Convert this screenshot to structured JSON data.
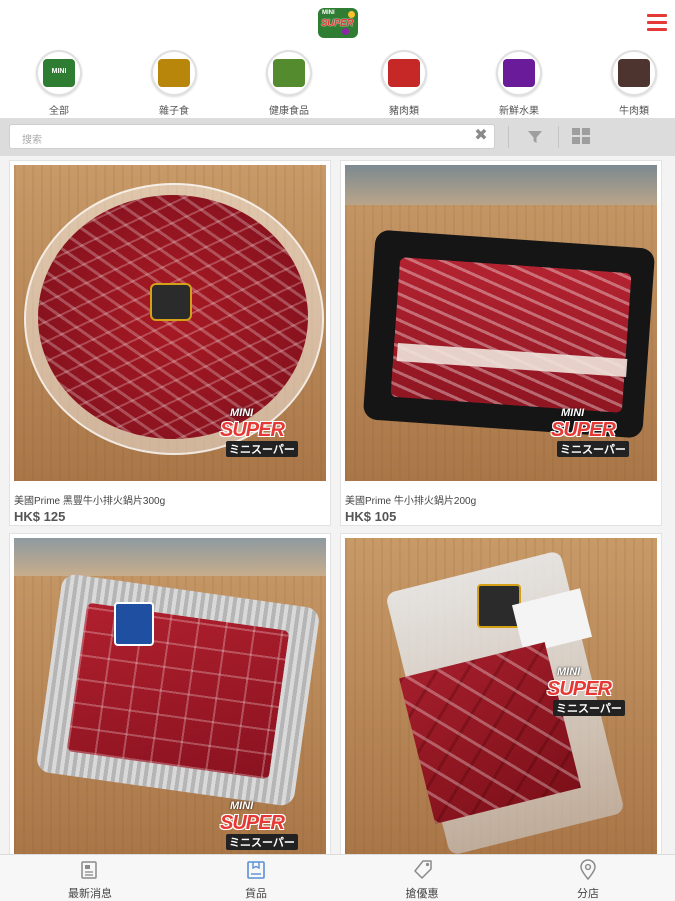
{
  "header": {
    "logo": {
      "line1": "MINI",
      "line2": "SUPER"
    },
    "menu_icon": "hamburger-menu-icon"
  },
  "categories": [
    {
      "label": "全部",
      "icon": "all-category-icon",
      "color": "#2e7d32"
    },
    {
      "label": "雜子食",
      "icon": "snacks-icon",
      "color": "#b8860b"
    },
    {
      "label": "健康食品",
      "icon": "health-food-icon",
      "color": "#558b2f"
    },
    {
      "label": "豬肉類",
      "icon": "pork-icon",
      "color": "#c62828"
    },
    {
      "label": "新鮮水果",
      "icon": "fresh-fruit-icon",
      "color": "#6a1b9a"
    },
    {
      "label": "牛肉類",
      "icon": "beef-icon",
      "color": "#4e342e"
    }
  ],
  "search": {
    "placeholder": "搜索"
  },
  "products": [
    {
      "name": "美國Prime 黑豐牛小排火鍋片300g",
      "price": "HK$ 125"
    },
    {
      "name": "美國Prime 牛小排火鍋片200g",
      "price": "HK$ 105"
    },
    {
      "name": "",
      "price": ""
    },
    {
      "name": "",
      "price": ""
    }
  ],
  "tabbar": [
    {
      "label": "最新消息",
      "icon": "news-icon"
    },
    {
      "label": "貨品",
      "icon": "products-icon"
    },
    {
      "label": "搶優惠",
      "icon": "coupon-tag-icon"
    },
    {
      "label": "分店",
      "icon": "location-pin-icon"
    }
  ],
  "colors": {
    "accent": "#e53935",
    "active_tab": "#5b8fd6"
  }
}
